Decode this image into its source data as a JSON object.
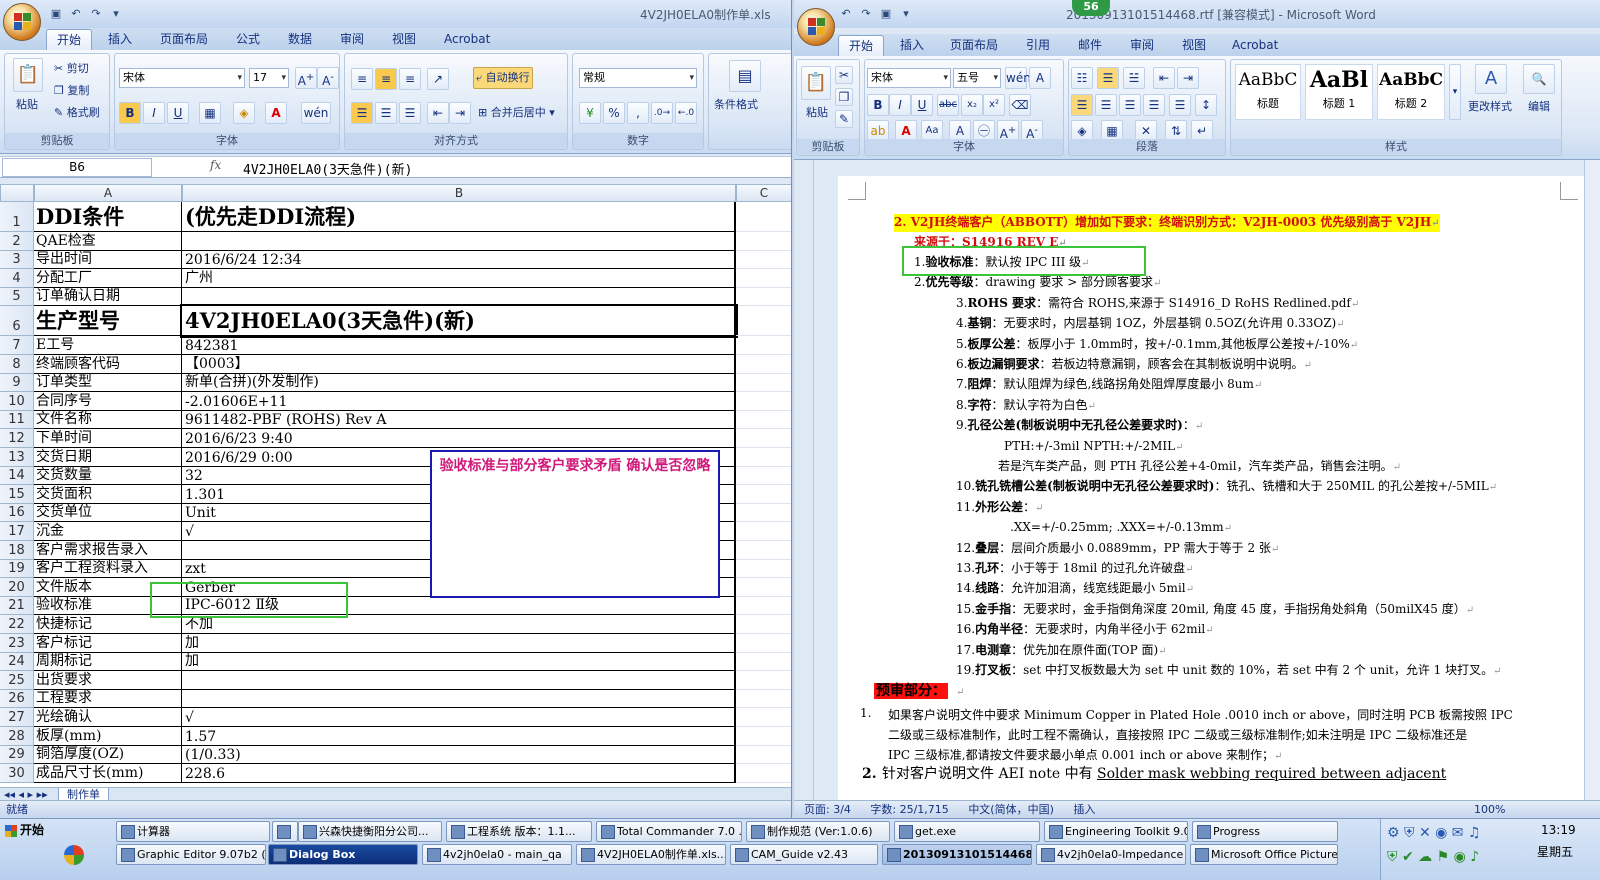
{
  "excel": {
    "title": "4V2JH0ELA0制作单.xls",
    "tabs": [
      "开始",
      "插入",
      "页面布局",
      "公式",
      "数据",
      "审阅",
      "视图",
      "Acrobat"
    ],
    "ribbon": {
      "paste": "粘贴",
      "cut": "剪切",
      "copy": "复制",
      "format_painter": "格式刷",
      "clipboard": "剪贴板",
      "font_name": "宋体",
      "font_size": "17",
      "font_group": "字体",
      "wrap": "自动换行",
      "merge": "合并后居中",
      "align_group": "对齐方式",
      "number_format": "常规",
      "number_group": "数字",
      "cond_format": "条件格式"
    },
    "name_box": "B6",
    "fx": "fx",
    "formula": "4V2JH0ELA0(3天急件)(新)",
    "columns": [
      "A",
      "B",
      "C"
    ],
    "rows": [
      {
        "n": "1",
        "a": "DDI条件",
        "b": "(优先走DDI流程)"
      },
      {
        "n": "2",
        "a": "QAE检查",
        "b": ""
      },
      {
        "n": "3",
        "a": "导出时间",
        "b": "2016/6/24 12:34"
      },
      {
        "n": "4",
        "a": "分配工厂",
        "b": "广州"
      },
      {
        "n": "5",
        "a": "订单确认日期",
        "b": ""
      },
      {
        "n": "6",
        "a": "生产型号",
        "b": "4V2JH0ELA0(3天急件)(新)"
      },
      {
        "n": "7",
        "a": "E工号",
        "b": "842381"
      },
      {
        "n": "8",
        "a": "终端顾客代码",
        "b": "【0003】"
      },
      {
        "n": "9",
        "a": "订单类型",
        "b": "新单(合拼)(外发制作)"
      },
      {
        "n": "10",
        "a": "合同序号",
        "b": "-2.01606E+11"
      },
      {
        "n": "11",
        "a": "文件名称",
        "b": "9611482-PBF (ROHS) Rev A"
      },
      {
        "n": "12",
        "a": "下单时间",
        "b": "2016/6/23 9:40"
      },
      {
        "n": "13",
        "a": "交货日期",
        "b": "2016/6/29 0:00"
      },
      {
        "n": "14",
        "a": "交货数量",
        "b": "32"
      },
      {
        "n": "15",
        "a": "交货面积",
        "b": "1.301"
      },
      {
        "n": "16",
        "a": "交货单位",
        "b": "Unit"
      },
      {
        "n": "17",
        "a": "沉金",
        "b": "√"
      },
      {
        "n": "18",
        "a": "客户需求报告录入",
        "b": ""
      },
      {
        "n": "19",
        "a": "客户工程资料录入",
        "b": "zxt"
      },
      {
        "n": "20",
        "a": "文件版本",
        "b": "Gerber"
      },
      {
        "n": "21",
        "a": "验收标准",
        "b": "IPC-6012 Ⅱ级"
      },
      {
        "n": "22",
        "a": "快捷标记",
        "b": "不加"
      },
      {
        "n": "23",
        "a": "客户标记",
        "b": "加"
      },
      {
        "n": "24",
        "a": "周期标记",
        "b": "加"
      },
      {
        "n": "25",
        "a": "出货要求",
        "b": ""
      },
      {
        "n": "26",
        "a": "工程要求",
        "b": ""
      },
      {
        "n": "27",
        "a": "光绘确认",
        "b": "√"
      },
      {
        "n": "28",
        "a": "板厚(mm)",
        "b": "1.57"
      },
      {
        "n": "29",
        "a": "铜箔厚度(OZ)",
        "b": "(1/0.33)"
      },
      {
        "n": "30",
        "a": "成品尺寸长(mm)",
        "b": "228.6"
      }
    ],
    "annotation": "验收标准与部分客户要求矛盾 确认是否忽略",
    "sheet_tab": "制作单",
    "status": "就绪"
  },
  "word": {
    "title": "20130913101514468.rtf [兼容模式] - Microsoft Word",
    "notification_count": "56",
    "tabs": [
      "开始",
      "插入",
      "页面布局",
      "引用",
      "邮件",
      "审阅",
      "视图",
      "Acrobat"
    ],
    "ribbon": {
      "paste": "粘贴",
      "clipboard": "剪贴板",
      "font_name": "宋体",
      "font_size": "五号",
      "font_group": "字体",
      "para_group": "段落",
      "style_sample": "AaBbC",
      "style_sample_big": "AaBl",
      "styles": [
        "标题",
        "标题 1",
        "标题 2"
      ],
      "change_styles": "更改样式",
      "styles_group": "样式",
      "edit": "编辑"
    },
    "doc": {
      "heading": "2. V2JH终端客户（ABBOTT）增加如下要求：终端识别方式：V2JH-0003  优先级别高于 V2JH",
      "source": "来源于：S14916 REV E",
      "items": [
        {
          "num": "1.",
          "label": "验收标准",
          "text": "：默认按 IPC III 级"
        },
        {
          "num": "2.",
          "label": "优先等级",
          "text": "：drawing 要求 > 部分顾客要求"
        },
        {
          "num": "3.",
          "label": "ROHS 要求",
          "text": "：需符合 ROHS,来源于 S14916_D RoHS Redlined.pdf"
        },
        {
          "num": "4.",
          "label": "基铜",
          "text": "：无要求时，内层基铜 1OZ，外层基铜 0.5OZ(允许用 0.33OZ)"
        },
        {
          "num": "5.",
          "label": "板厚公差",
          "text": "：板厚小于 1.0mm时，按+/-0.1mm,其他板厚公差按+/-10%"
        },
        {
          "num": "6.",
          "label": "板边漏铜要求",
          "text": "：若板边特意漏铜，顾客会在其制板说明中说明。"
        },
        {
          "num": "7.",
          "label": "阻焊",
          "text": "：默认阻焊为绿色,线路拐角处阻焊厚度最小 8um"
        },
        {
          "num": "8.",
          "label": "字符",
          "text": "：默认字符为白色"
        },
        {
          "num": "9.",
          "label": "孔径公差(制板说明中无孔径公差要求时)",
          "text": "："
        },
        {
          "num": "",
          "label": "",
          "text": "PTH:+/-3mil   NPTH:+/-2MIL"
        },
        {
          "num": "",
          "label": "",
          "text": "若是汽车类产品，则 PTH 孔径公差+4-0mil，汽车类产品，销售会注明。"
        },
        {
          "num": "10.",
          "label": "铣孔铣槽公差(制板说明中无孔径公差要求时)",
          "text": "：铣孔、铣槽和大于 250MIL 的孔公差按+/-5MIL"
        },
        {
          "num": "11.",
          "label": "外形公差",
          "text": "："
        },
        {
          "num": "",
          "label": "",
          "text": ".XX=+/-0.25mm; .XXX=+/-0.13mm"
        },
        {
          "num": "12.",
          "label": "叠层",
          "text": "：层间介质最小 0.0889mm，PP 需大于等于 2 张"
        },
        {
          "num": "13.",
          "label": "孔环",
          "text": "：小于等于 18mil 的过孔允许破盘"
        },
        {
          "num": "14.",
          "label": "线路",
          "text": "：允许加泪滴，线宽线距最小 5mil"
        },
        {
          "num": "15.",
          "label": "金手指",
          "text": "：无要求时，金手指倒角深度 20mil, 角度 45 度，手指拐角处斜角（50milX45 度）"
        },
        {
          "num": "16.",
          "label": "内角半径",
          "text": "：无要求时，内角半径小于 62mil"
        },
        {
          "num": "17.",
          "label": "电测章",
          "text": "：优先加在原件面(TOP 面)"
        },
        {
          "num": "19.",
          "label": "打叉板",
          "text": "：set 中打叉板数最大为 set 中 unit 数的 10%，若 set 中有 2 个 unit，允许 1 块打叉。"
        }
      ],
      "section": "预审部分：",
      "p1_num": "1.",
      "p1_lines": [
        "如果客户说明文件中要求 Minimum Copper in Plated Hole .0010 inch or above，同时注明 PCB 板需按照 IPC",
        "二级或三级标准制作，此时工程不需确认，直接按照 IPC 二级或三级标准制作;如未注明是 IPC 二级标准还是",
        "IPC 三级标准,都请按文件要求最小单点 0.001 inch or above 来制作；"
      ],
      "p2_num": "2.",
      "p2_text": "针对客户说明文件 AEI note 中有",
      "p2_underline": "Solder mask webbing required between adjacent"
    },
    "status": {
      "page": "页面: 3/4",
      "words": "字数: 25/1,715",
      "lang": "中文(简体，中国)",
      "mode": "插入",
      "zoom": "100%"
    }
  },
  "taskbar": {
    "start": "开始",
    "row1": [
      "计算器",
      "",
      "兴森快捷衡阳分公司...",
      "工程系统  版本：1.1...",
      "Total Commander 7.0 ...",
      "制作规范 (Ver:1.0.6)",
      "get.exe",
      "Engineering Toolkit 9.0...",
      "Progress"
    ],
    "row2": [
      "Graphic Editor 9.07b2 (...",
      "Dialog Box",
      "4v2jh0ela0 - main_qa",
      "4V2JH0ELA0制作单.xls...",
      "CAM_Guide v2.43",
      "20130913101514468...",
      "4v2jh0ela0-Impedance ...",
      "Microsoft Office Picture..."
    ],
    "time": "13:19",
    "day": "星期五"
  }
}
